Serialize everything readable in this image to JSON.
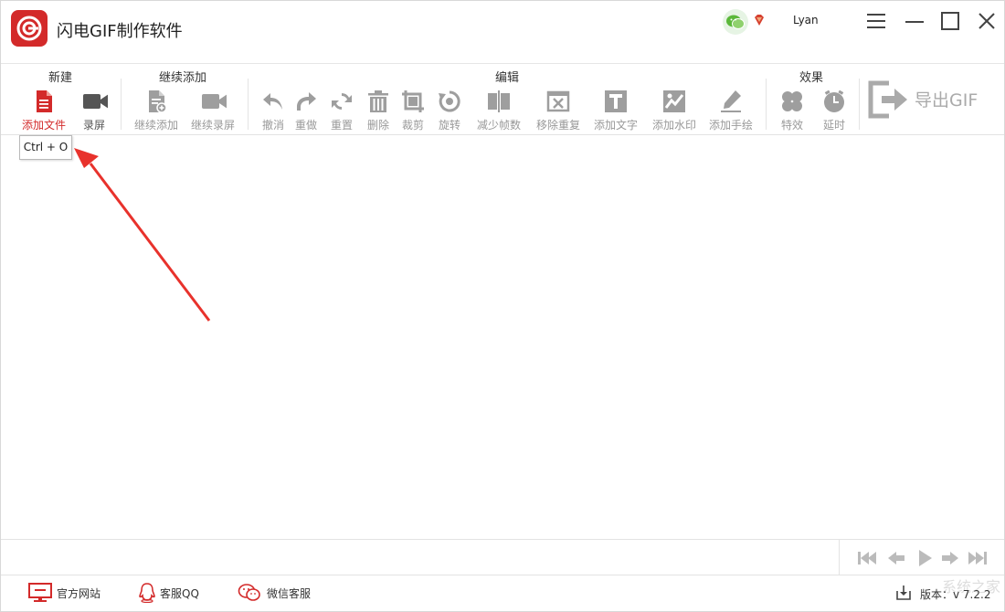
{
  "window": {
    "title": "闪电GIF制作软件",
    "user": "Lyan",
    "buttons": [
      "menu-icon",
      "minimize-icon",
      "maximize-icon",
      "close-icon"
    ]
  },
  "toolbar": {
    "groups": {
      "new": "新建",
      "continue": "继续添加",
      "edit": "编辑",
      "effects": "效果"
    },
    "tools": {
      "add_file": "添加文件",
      "record": "录屏",
      "continue_add": "继续添加",
      "continue_record": "继续录屏",
      "undo": "撤消",
      "redo": "重做",
      "reset": "重置",
      "delete": "删除",
      "crop": "裁剪",
      "rotate": "旋转",
      "reduce_frames": "减少帧数",
      "remove_duplicate": "移除重复",
      "add_text": "添加文字",
      "add_watermark": "添加水印",
      "add_drawing": "添加手绘",
      "effects": "特效",
      "delay": "延时"
    },
    "export": "导出GIF"
  },
  "tooltip": "Ctrl + O",
  "status": {
    "website": "官方网站",
    "qq": "客服QQ",
    "wechat": "微信客服",
    "version": "版本：v 7.2.2"
  },
  "watermark": "系统之家",
  "colors": {
    "accent": "#d32a2a",
    "icon_gray": "#9e9e9e",
    "annotation": "#e8322c"
  }
}
